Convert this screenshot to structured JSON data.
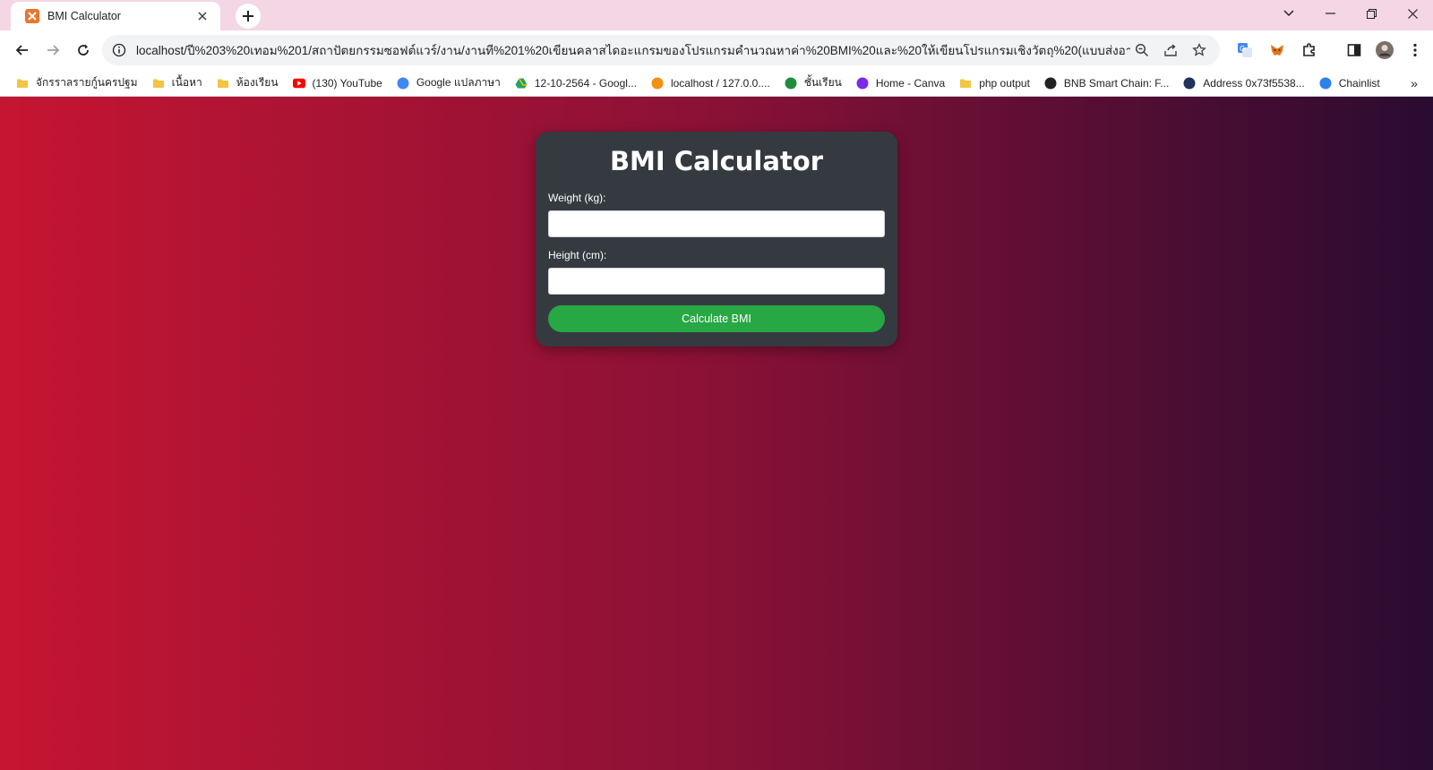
{
  "browser": {
    "tab_title": "BMI Calculator",
    "address": "localhost/ปี%203%20เทอม%201/สถาปัตยกรรมซอฟต์แวร์/งาน/งานที่%201%20เขียนคลาสไดอะแกรมของโปรแกรมคำนวณหาค่า%20BMI%20และ%20ให้เขียนโปรแกรมเชิงวัตถุ%20(แบบส่งอาจารย์)/",
    "bookmarks": [
      {
        "label": "จักรราลรายก์ูนครปฐม",
        "icon": "folder-icon",
        "color": "#f4c542"
      },
      {
        "label": "เนื้อหา",
        "icon": "folder-icon",
        "color": "#f4c542"
      },
      {
        "label": "ห้องเรียน",
        "icon": "folder-icon",
        "color": "#f4c542"
      },
      {
        "label": "(130) YouTube",
        "icon": "youtube-icon",
        "color": "#ff0000"
      },
      {
        "label": "Google แปลภาษา",
        "icon": "google-translate-icon",
        "color": "#4285f4"
      },
      {
        "label": "12-10-2564 - Googl...",
        "icon": "google-drive-icon",
        "color": "#1fa463"
      },
      {
        "label": "localhost / 127.0.0....",
        "icon": "phpmyadmin-icon",
        "color": "#f29111"
      },
      {
        "label": "ชั้นเรียน",
        "icon": "classroom-icon",
        "color": "#1e8e3e"
      },
      {
        "label": "Home - Canva",
        "icon": "canva-icon",
        "color": "#7d2ae8"
      },
      {
        "label": "php output",
        "icon": "folder-icon",
        "color": "#f4c542"
      },
      {
        "label": "BNB Smart Chain: F...",
        "icon": "bscscan-icon",
        "color": "#222222"
      },
      {
        "label": "Address 0x73f5538...",
        "icon": "etherscan-icon",
        "color": "#21325b"
      },
      {
        "label": "Chainlist",
        "icon": "chainlist-icon",
        "color": "#2f80ed"
      }
    ]
  },
  "app": {
    "title": "BMI Calculator",
    "weight_label": "Weight (kg):",
    "height_label": "Height (cm):",
    "weight_value": "",
    "height_value": "",
    "button_label": "Calculate BMI"
  },
  "colors": {
    "tabstrip": "#f4d6e4",
    "card": "#343a40",
    "button": "#28a745",
    "gradient_start": "#c51532",
    "gradient_end": "#2a0b31"
  }
}
